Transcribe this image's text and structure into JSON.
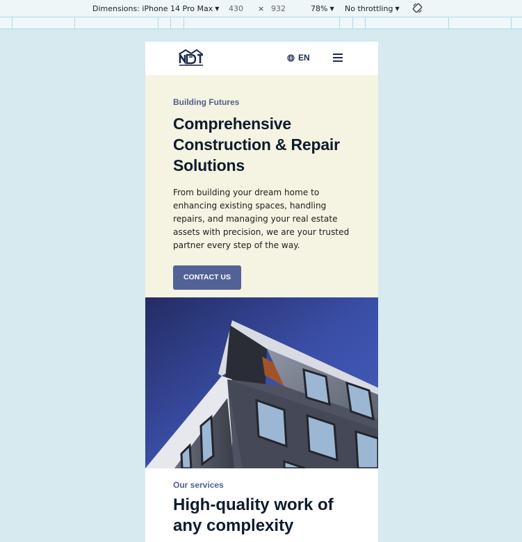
{
  "devtools": {
    "dimensions_label": "Dimensions: iPhone 14 Pro Max",
    "width": "430",
    "times": "×",
    "height": "932",
    "zoom": "78%",
    "throttling": "No throttling"
  },
  "header": {
    "language": "EN"
  },
  "hero": {
    "eyebrow": "Building Futures",
    "title": "Comprehensive Construction & Repair Solutions",
    "description": "From building your dream home to enhancing existing spaces, handling repairs, and managing your real estate assets with precision, we are your trusted partner every step of the way.",
    "cta_label": "CONTACT US"
  },
  "services": {
    "eyebrow": "Our services",
    "title": "High-quality work of any complexity"
  }
}
